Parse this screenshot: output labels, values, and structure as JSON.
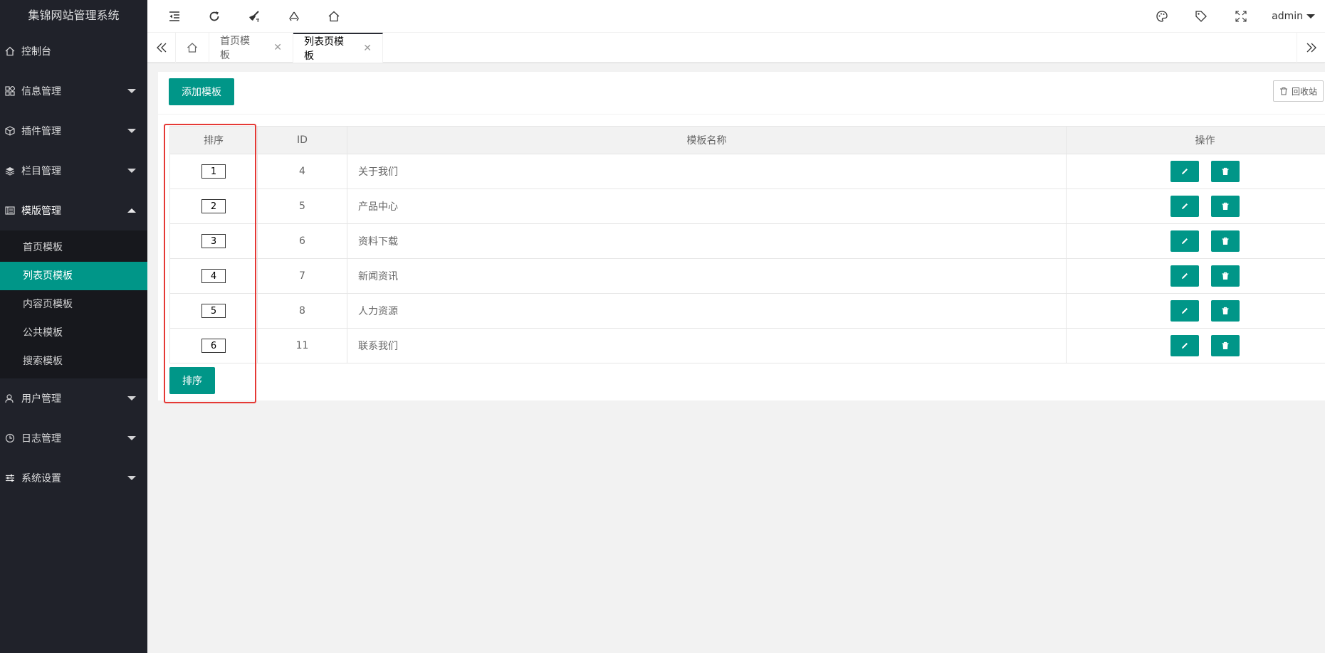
{
  "app": {
    "title": "集锦网站管理系统"
  },
  "sidebar": {
    "items": [
      {
        "label": "控制台",
        "icon": "home-icon"
      },
      {
        "label": "信息管理",
        "icon": "apps-icon"
      },
      {
        "label": "插件管理",
        "icon": "cube-icon"
      },
      {
        "label": "栏目管理",
        "icon": "layers-icon"
      },
      {
        "label": "模版管理",
        "icon": "template-icon"
      },
      {
        "label": "用户管理",
        "icon": "user-icon"
      },
      {
        "label": "日志管理",
        "icon": "clock-icon"
      },
      {
        "label": "系统设置",
        "icon": "sliders-icon"
      }
    ],
    "submenu": [
      {
        "label": "首页模板"
      },
      {
        "label": "列表页模板",
        "active": true
      },
      {
        "label": "内容页模板"
      },
      {
        "label": "公共模板"
      },
      {
        "label": "搜索模板"
      }
    ]
  },
  "header": {
    "user": "admin"
  },
  "tabs": [
    {
      "label": "首页模板"
    },
    {
      "label": "列表页模板",
      "active": true
    }
  ],
  "toolbar": {
    "add_label": "添加模板",
    "recycle_label": "回收站"
  },
  "table": {
    "headers": [
      "排序",
      "ID",
      "模板名称",
      "操作"
    ],
    "rows": [
      {
        "sort": "1",
        "id": "4",
        "name": "关于我们"
      },
      {
        "sort": "2",
        "id": "5",
        "name": "产品中心"
      },
      {
        "sort": "3",
        "id": "6",
        "name": "资料下载"
      },
      {
        "sort": "4",
        "id": "7",
        "name": "新闻资讯"
      },
      {
        "sort": "5",
        "id": "8",
        "name": "人力资源"
      },
      {
        "sort": "6",
        "id": "11",
        "name": "联系我们"
      }
    ]
  },
  "sort_button": "排序",
  "colors": {
    "accent": "#009688",
    "sidebar_bg": "#20222a",
    "highlight": "#e53935"
  }
}
